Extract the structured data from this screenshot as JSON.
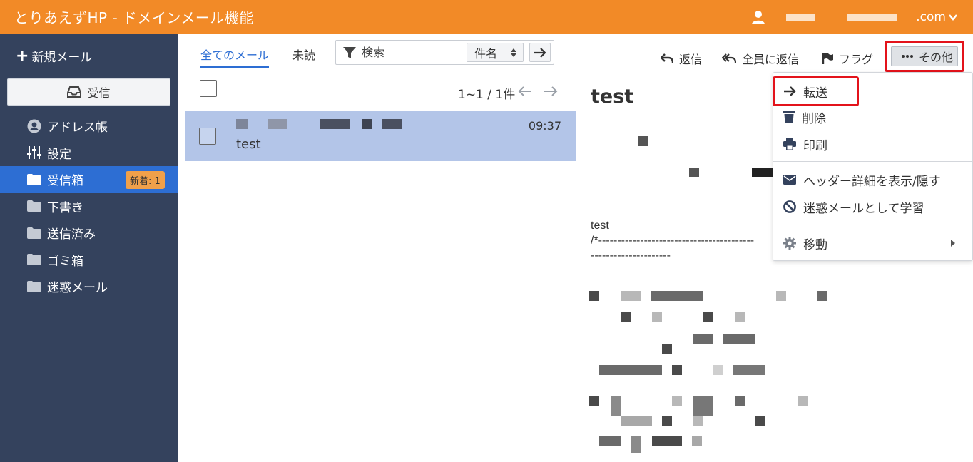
{
  "app": {
    "title": "とりあえずHP - ドメインメール機能",
    "user_domain": ".com",
    "accent": "#f28a27"
  },
  "sidebar": {
    "compose_label": "新規メール",
    "receive_label": "受信",
    "items": [
      {
        "label": "アドレス帳",
        "icon": "address-book-icon"
      },
      {
        "label": "設定",
        "icon": "sliders-icon"
      },
      {
        "label": "受信箱",
        "icon": "folder-icon",
        "badge": "新着: 1",
        "active": true
      },
      {
        "label": "下書き",
        "icon": "folder-icon"
      },
      {
        "label": "送信済み",
        "icon": "folder-icon"
      },
      {
        "label": "ゴミ箱",
        "icon": "folder-icon"
      },
      {
        "label": "迷惑メール",
        "icon": "folder-icon"
      }
    ]
  },
  "list": {
    "tab_all": "全てのメール",
    "tab_unread": "未読",
    "search_placeholder": "検索",
    "search_field": "件名",
    "pager": "1~1 / 1件",
    "messages": [
      {
        "subject": "test",
        "time": "09:37"
      }
    ]
  },
  "reader": {
    "toolbar": {
      "reply": "返信",
      "reply_all": "全員に返信",
      "flag": "フラグ",
      "more": "その他"
    },
    "subject": "test",
    "body_line1": "test",
    "body_line2": "/*-----------------------------------------",
    "body_line3": "---------------------"
  },
  "menu": {
    "forward": "転送",
    "delete": "削除",
    "print": "印刷",
    "toggle_headers": "ヘッダー詳細を表示/隠す",
    "mark_spam": "迷惑メールとして学習",
    "move": "移動"
  }
}
